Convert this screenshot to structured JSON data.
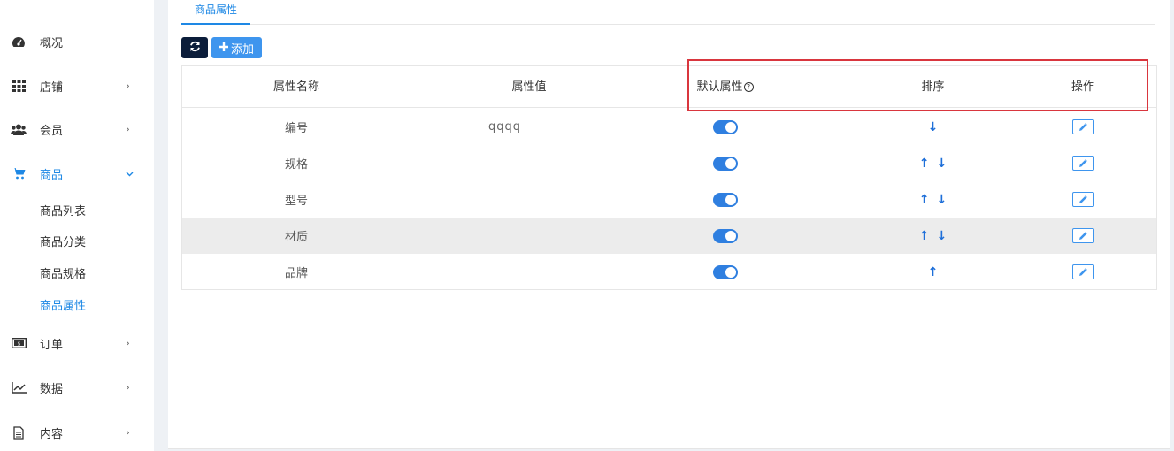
{
  "sidebar": {
    "items": [
      {
        "label": "概况",
        "icon": "dashboard-icon",
        "chevron": ""
      },
      {
        "label": "店铺",
        "icon": "grid-icon",
        "chevron": "›"
      },
      {
        "label": "会员",
        "icon": "users-icon",
        "chevron": "›"
      },
      {
        "label": "商品",
        "icon": "cart-icon",
        "chevron": "⌄"
      },
      {
        "label": "订单",
        "icon": "money-icon",
        "chevron": "›"
      },
      {
        "label": "数据",
        "icon": "chart-line-icon",
        "chevron": "›"
      },
      {
        "label": "内容",
        "icon": "document-icon",
        "chevron": "›"
      }
    ],
    "sub_items": [
      "商品列表",
      "商品分类",
      "商品规格",
      "商品属性"
    ],
    "active_item": "商品",
    "active_sub_item": "商品属性"
  },
  "tabs": [
    {
      "label": "商品属性"
    }
  ],
  "toolbar": {
    "add_label": "添加"
  },
  "table": {
    "headers": [
      "属性名称",
      "属性值",
      "默认属性",
      "排序",
      "操作"
    ],
    "help_symbol": "?",
    "rows": [
      {
        "name": "编号",
        "value": "qqqq",
        "default_on": true,
        "up": "",
        "down": "↓"
      },
      {
        "name": "规格",
        "value": "",
        "default_on": true,
        "up": "↑",
        "down": "↓"
      },
      {
        "name": "型号",
        "value": "",
        "default_on": true,
        "up": "↑",
        "down": "↓"
      },
      {
        "name": "材质",
        "value": "",
        "default_on": true,
        "up": "↑",
        "down": "↓"
      },
      {
        "name": "品牌",
        "value": "",
        "default_on": true,
        "up": "↑",
        "down": ""
      }
    ]
  },
  "colors": {
    "accent": "#1e88e5",
    "toggle": "#2f7fe0",
    "highlight_box": "#d9363e",
    "refresh_button": "#0b1d3a"
  }
}
